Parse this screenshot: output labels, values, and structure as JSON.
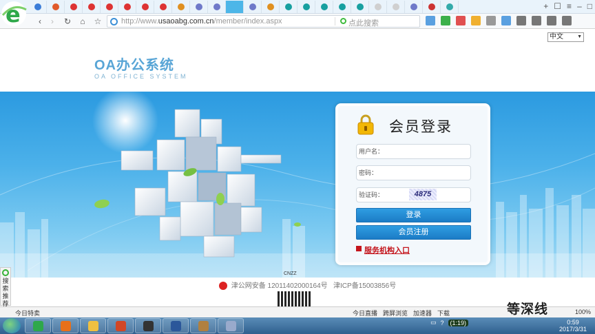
{
  "browser": {
    "url_prefix": "http://www.",
    "url_domain": "usaoabg.com.cn",
    "url_path": "/member/index.aspx",
    "search_placeholder": "点此搜索",
    "tab_colors": [
      "#3b7dd8",
      "#e05a2a",
      "#d33",
      "#d33",
      "#d33",
      "#d33",
      "#d33",
      "#d33",
      "#e09020",
      "#6f79c9",
      "#6f79c9",
      "#4db6e8",
      "#6f79c9",
      "#e09020",
      "#18a0a0",
      "#18a0a0",
      "#18a0a0",
      "#18a0a0",
      "#18a0a0",
      "#d0d0d0",
      "#d0d0d0",
      "#6f79c9",
      "#c33",
      "#3aa"
    ]
  },
  "page": {
    "language": "中文",
    "brand_title": "OA办公系统",
    "brand_subtitle": "OA OFFICE SYSTEM"
  },
  "login": {
    "title": "会员登录",
    "username_label": "用户名：",
    "password_label": "密码：",
    "captcha_label": "验证码：",
    "captcha_value": "4875",
    "login_button": "登录",
    "register_button": "会员注册",
    "service_link": "服务机构入口"
  },
  "footer": {
    "cnzz": "CNZZ",
    "police_record": "津公网安备 12011402000164号",
    "icp_record": "津ICP备15003856号"
  },
  "sidebar": {
    "search_recommend": "搜索推荐"
  },
  "statusbar": {
    "left": "今日特卖",
    "items": [
      "今日直播",
      "跨屏浏览",
      "加速器",
      "下载"
    ],
    "zoom": "100%"
  },
  "taskbar": {
    "tray_pill": "(1:19)",
    "time": "0:59",
    "date": "2017/3/31"
  },
  "watermark": "等深线"
}
